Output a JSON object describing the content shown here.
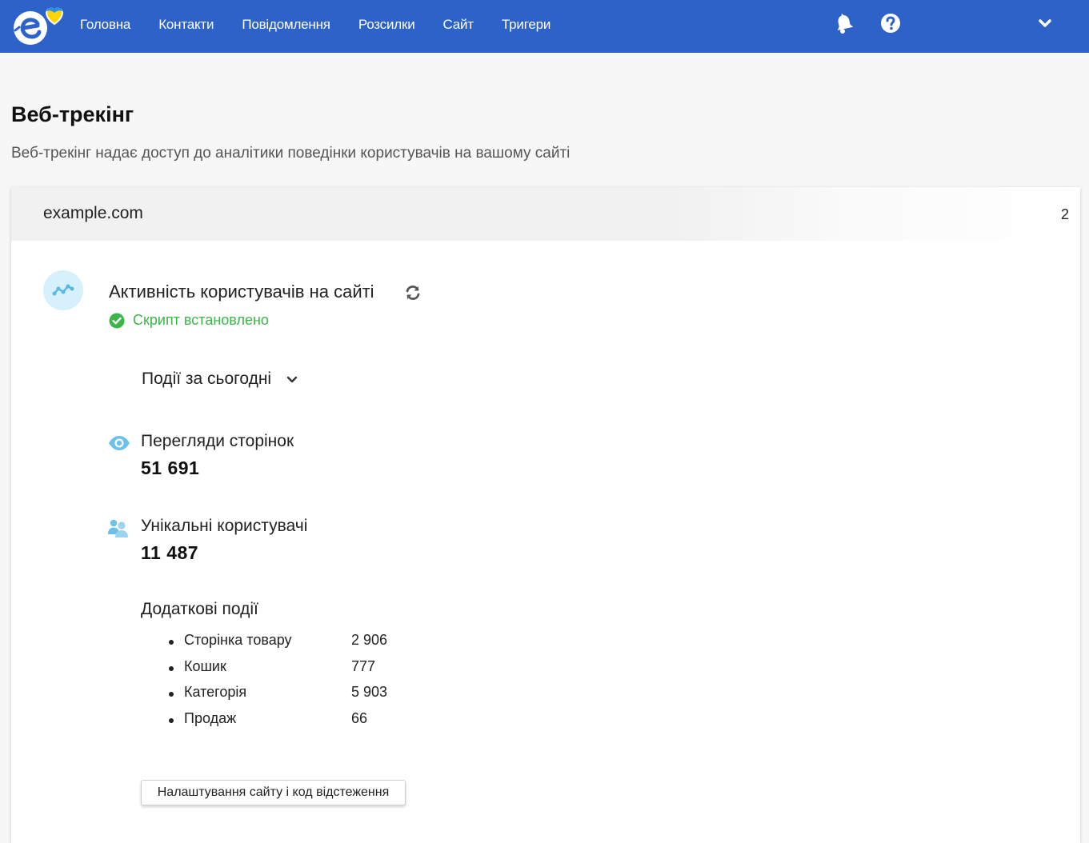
{
  "nav": {
    "items": [
      {
        "label": "Головна",
        "id": "home"
      },
      {
        "label": "Контакти",
        "id": "contacts"
      },
      {
        "label": "Повідомлення",
        "id": "messages"
      },
      {
        "label": "Розсилки",
        "id": "mailings"
      },
      {
        "label": "Сайт",
        "id": "site"
      },
      {
        "label": "Тригери",
        "id": "triggers"
      }
    ],
    "icons": [
      "bell-icon",
      "help-icon",
      "chevron-down-icon"
    ],
    "bar_color": "#2d62c8"
  },
  "page": {
    "title": "Веб-трекінг",
    "subtitle": "Веб-трекінг надає доступ до аналітики поведінки користувачів на вашому сайті"
  },
  "site": {
    "domain": "example.com",
    "count": "2",
    "activity_title": "Активність користувачів на сайті",
    "script_status": "Скрипт встановлено",
    "status_color": "#3cb54a",
    "period_label": "Події за сьогодні",
    "metrics": {
      "pageviews": {
        "label": "Перегляди сторінок",
        "value": "51 691",
        "icon": "eye-icon"
      },
      "users": {
        "label": "Унікальні користувачі",
        "value": "11 487",
        "icon": "users-icon"
      }
    },
    "extra_events": {
      "title": "Додаткові події",
      "items": [
        {
          "name": "Сторінка товару",
          "value": "2 906"
        },
        {
          "name": "Кошик",
          "value": "777"
        },
        {
          "name": "Категорія",
          "value": "5 903"
        },
        {
          "name": "Продаж",
          "value": "66"
        }
      ]
    },
    "settings_button": "Налаштування сайту і код відстеження"
  }
}
